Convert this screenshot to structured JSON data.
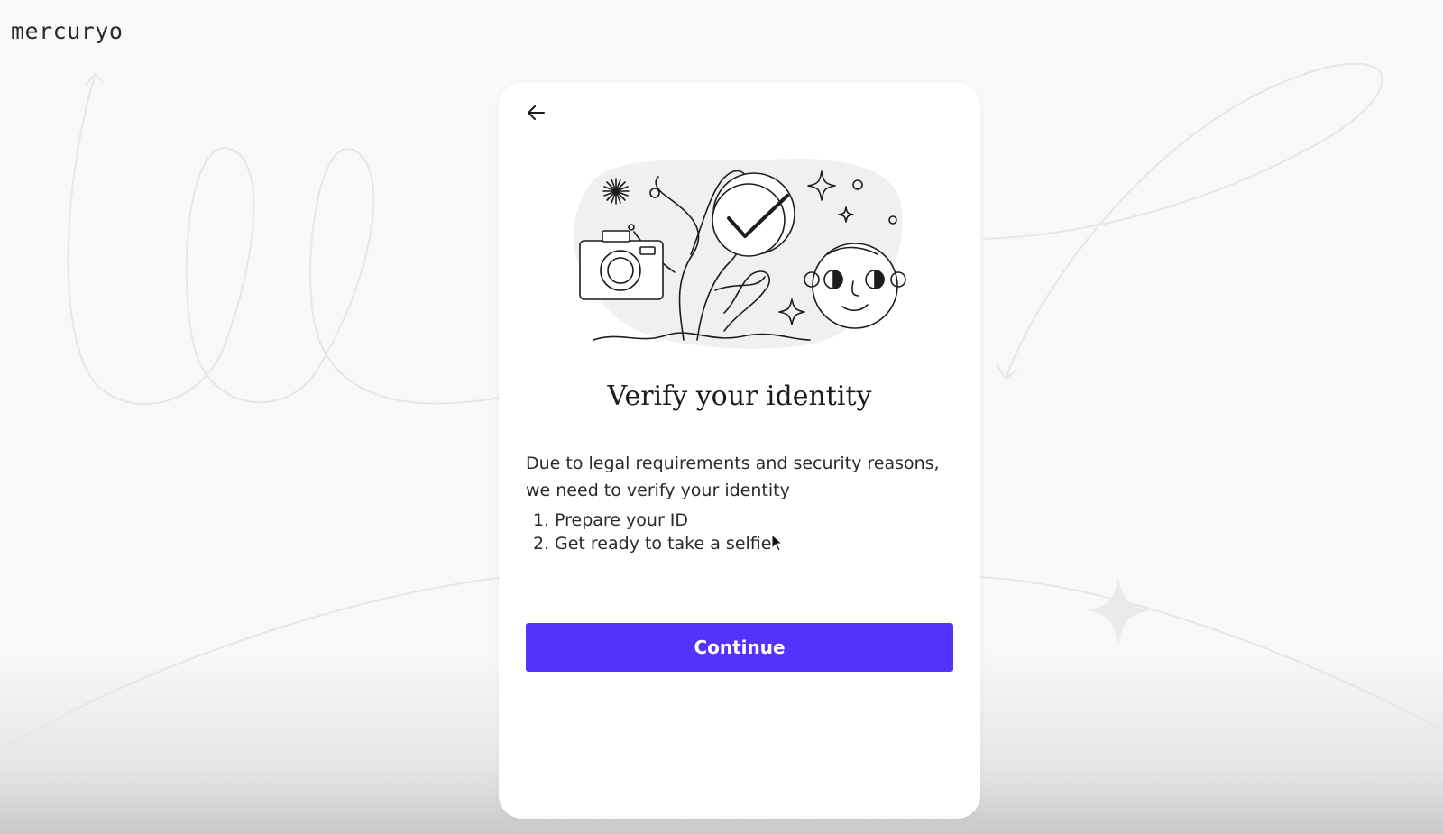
{
  "app": {
    "logo_text": "mercuryo"
  },
  "card": {
    "back_icon": "arrow-left-icon",
    "illustration": "identity-verification-illustration",
    "title": "Verify your identity",
    "description": "Due to legal requirements and security reasons, we need to verify your identity",
    "steps": [
      {
        "number": "1.",
        "label": "Prepare your ID"
      },
      {
        "number": "2.",
        "label": "Get ready to take a selfie"
      }
    ],
    "continue_label": "Continue"
  },
  "colors": {
    "accent": "#5533ff",
    "background": "#f8f8f8",
    "card": "#ffffff",
    "text": "#2a2a2a"
  }
}
